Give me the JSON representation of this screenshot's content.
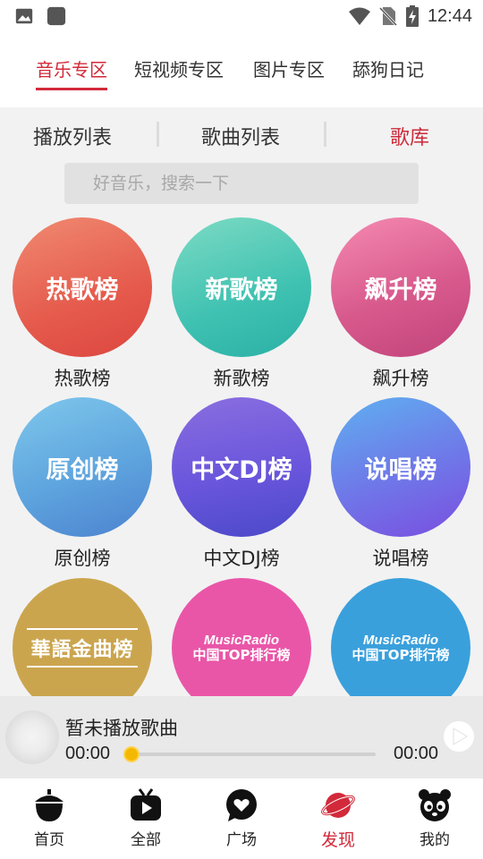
{
  "status_bar": {
    "time": "12:44",
    "icons": [
      "image-icon",
      "app-icon",
      "wifi-icon",
      "no-sim-icon",
      "battery-charging-icon"
    ]
  },
  "top_tabs": [
    {
      "label": "音乐专区",
      "active": true
    },
    {
      "label": "短视频专区",
      "active": false
    },
    {
      "label": "图片专区",
      "active": false
    },
    {
      "label": "舔狗日记",
      "active": false
    }
  ],
  "sub_tabs": [
    {
      "label": "播放列表",
      "active": false
    },
    {
      "label": "歌曲列表",
      "active": false
    },
    {
      "label": "歌库",
      "active": true
    }
  ],
  "search": {
    "placeholder": "好音乐，搜索一下"
  },
  "charts": [
    {
      "title": "热歌榜",
      "caption": "热歌榜"
    },
    {
      "title": "新歌榜",
      "caption": "新歌榜"
    },
    {
      "title": "飙升榜",
      "caption": "飙升榜"
    },
    {
      "title": "原创榜",
      "caption": "原创榜"
    },
    {
      "title": "中文DJ榜",
      "caption": "中文DJ榜"
    },
    {
      "title": "说唱榜",
      "caption": "说唱榜"
    },
    {
      "title": "華語金曲榜"
    },
    {
      "title_top": "MusicRadio",
      "title_bottom": "中国TOP排行榜"
    },
    {
      "title_top": "MusicRadio",
      "title_bottom": "中国TOP排行榜"
    }
  ],
  "player": {
    "song": "暂未播放歌曲",
    "current_time": "00:00",
    "total_time": "00:00",
    "progress": 0
  },
  "bottom_nav": [
    {
      "label": "首页",
      "icon": "acorn-icon",
      "active": false
    },
    {
      "label": "全部",
      "icon": "tv-icon",
      "active": false
    },
    {
      "label": "广场",
      "icon": "chat-heart-icon",
      "active": false
    },
    {
      "label": "发现",
      "icon": "planet-icon",
      "active": true
    },
    {
      "label": "我的",
      "icon": "panda-icon",
      "active": false
    }
  ],
  "colors": {
    "accent": "#d22a3a",
    "progress_thumb": "#f5b800"
  }
}
